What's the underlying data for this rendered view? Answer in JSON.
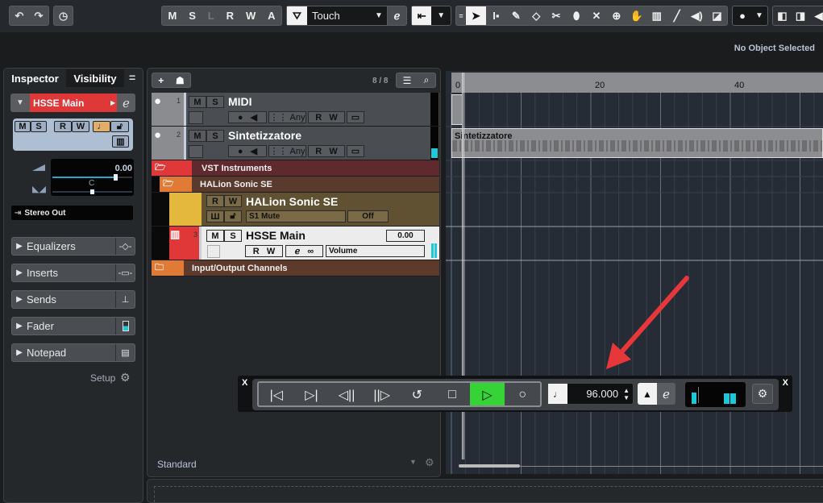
{
  "toolbar": {
    "undo_icon": "undo-icon",
    "redo_icon": "redo-icon",
    "history_icon": "history-icon",
    "automation_buttons": [
      "M",
      "S",
      "L",
      "R",
      "W",
      "A"
    ],
    "automation_mode": "Touch",
    "tools": [
      "object-selection",
      "range-selection",
      "draw",
      "erase",
      "split",
      "glue",
      "mute",
      "zoom",
      "play/hand",
      "comp",
      "line",
      "mute-tool",
      "color"
    ]
  },
  "info_line": {
    "status": "No Object Selected"
  },
  "inspector": {
    "tabs": [
      "Inspector",
      "Visibility"
    ],
    "menu_icon": "=",
    "track_name": "HSSE Main",
    "track_buttons": [
      "M",
      "S",
      "R",
      "W"
    ],
    "volume_value": "0.00",
    "pan_value": "C",
    "output": "Stereo Out",
    "sections": [
      {
        "label": "Equalizers",
        "icon": "eq-icon"
      },
      {
        "label": "Inserts",
        "icon": "inserts-icon"
      },
      {
        "label": "Sends",
        "icon": "sends-icon"
      },
      {
        "label": "Fader",
        "icon": "fader-icon"
      },
      {
        "label": "Notepad",
        "icon": "notepad-icon"
      }
    ],
    "setup_label": "Setup"
  },
  "tracklist": {
    "count": "8 / 8",
    "tracks": [
      {
        "number": "1",
        "name": "MIDI",
        "channel": "Any"
      },
      {
        "number": "2",
        "name": "Sintetizzatore",
        "channel": "Any"
      }
    ],
    "folder_vst": "VST Instruments",
    "folder_halion": "HALion Sonic SE",
    "instrument": {
      "name": "HALion Sonic SE",
      "param": "S1 Mute",
      "param_value": "Off"
    },
    "hsse": {
      "number": "3",
      "name": "HSSE Main",
      "value": "0.00",
      "automation": "Volume"
    },
    "folder_io": "Input/Output Channels",
    "preset": "Standard"
  },
  "arrange": {
    "ruler_labels": [
      "0",
      "20",
      "40"
    ],
    "event_name": "Sintetizzatore"
  },
  "transport": {
    "close_label": "X",
    "buttons": [
      "go-to-start",
      "go-to-end",
      "rewind",
      "forward",
      "cycle",
      "stop",
      "play",
      "record"
    ],
    "tempo": "96.000",
    "play_color": "#35d335"
  },
  "colors": {
    "accent_cyan": "#1fc8d8",
    "track_red": "#e03838",
    "folder_orange": "#e07a34",
    "instrument_yellow": "#e4b83c",
    "arrow_red": "#e8373a"
  }
}
